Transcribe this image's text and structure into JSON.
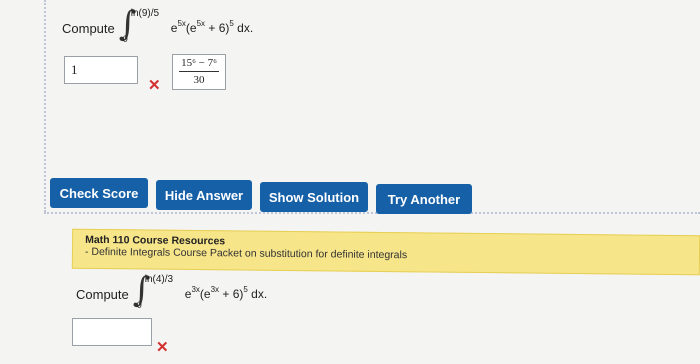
{
  "problem1": {
    "prompt": "Compute",
    "upper_limit": "ln(9)/5",
    "lower_limit": "0",
    "integrand_a": "e",
    "integrand_a_exp": "5x",
    "integrand_b": "(e",
    "integrand_b_exp": "5x",
    "integrand_c": " + 6)",
    "integrand_c_exp": "5",
    "integrand_d": " dx."
  },
  "answer1": {
    "value": "1",
    "correct_numerator": "15⁶ − 7⁶",
    "correct_denominator": "30"
  },
  "marks": {
    "incorrect": "✕"
  },
  "buttons": {
    "check_score": "Check Score",
    "hide_answer": "Hide Answer",
    "show_solution": "Show Solution",
    "try_another": "Try Another"
  },
  "resources": {
    "title": "Math 110 Course Resources",
    "link": "- Definite Integrals Course Packet on substitution for definite integrals"
  },
  "problem2": {
    "prompt": "Compute",
    "upper_limit": "ln(4)/3",
    "lower_limit": "0",
    "integrand_a": "e",
    "integrand_a_exp": "3x",
    "integrand_b": "(e",
    "integrand_b_exp": "3x",
    "integrand_c": " + 6)",
    "integrand_c_exp": "5",
    "integrand_d": " dx."
  },
  "colors": {
    "button": "#1660a8",
    "error": "#d32f2f",
    "highlight": "#f7e58a"
  }
}
